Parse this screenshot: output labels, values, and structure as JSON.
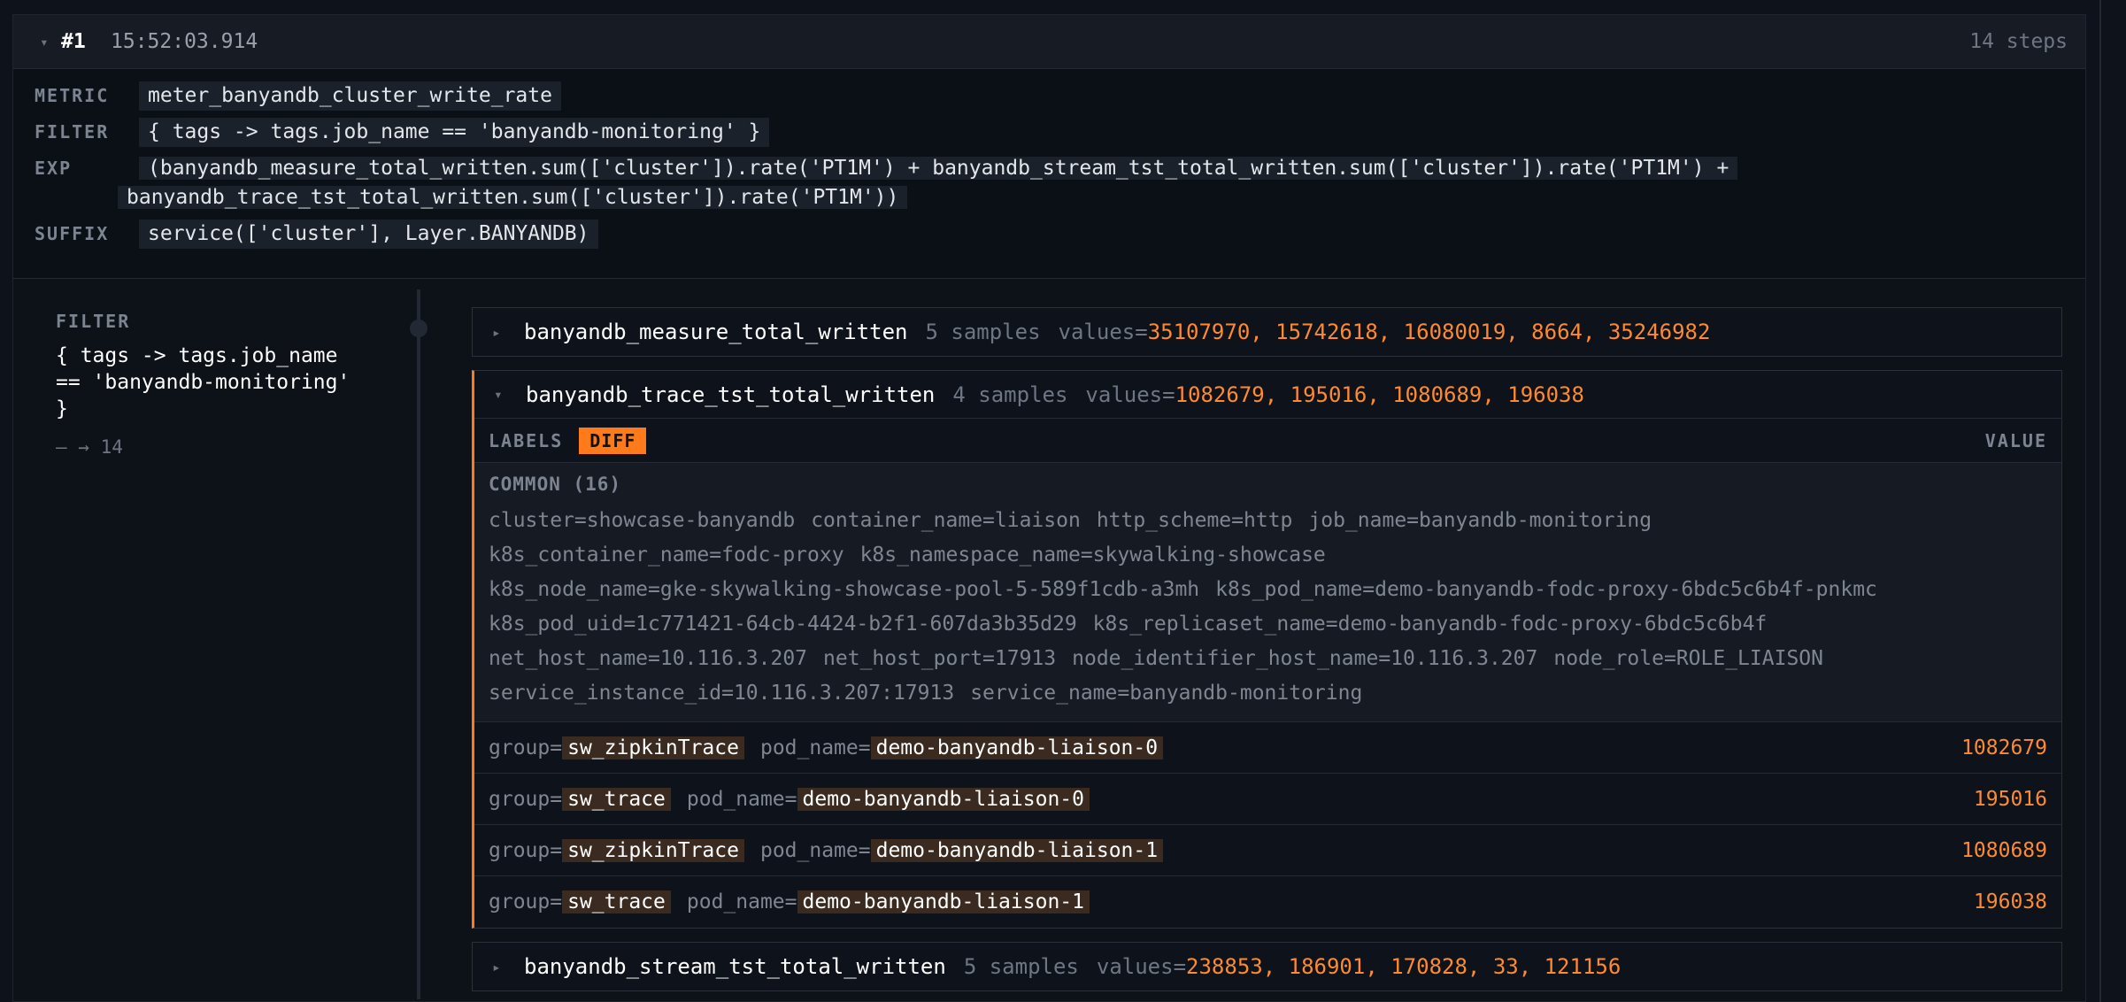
{
  "header": {
    "caret": "▾",
    "number": "#1",
    "time": "15:52:03.914",
    "steps": "14 steps"
  },
  "meta": {
    "metric_key": "METRIC",
    "metric_value": "meter_banyandb_cluster_write_rate",
    "filter_key": "FILTER",
    "filter_value": "{ tags -> tags.job_name == 'banyandb-monitoring' }",
    "exp_key": "EXP",
    "exp_line1": "(banyandb_measure_total_written.sum(['cluster']).rate('PT1M') + banyandb_stream_tst_total_written.sum(['cluster']).rate('PT1M') +",
    "exp_line2": "banyandb_trace_tst_total_written.sum(['cluster']).rate('PT1M'))",
    "suffix_key": "SUFFIX",
    "suffix_value": "service(['cluster'], Layer.BANYANDB)"
  },
  "step": {
    "label": "FILTER",
    "code": "{ tags -> tags.job_name\n== 'banyandb-monitoring'\n}",
    "count": "— → 14"
  },
  "items": [
    {
      "twisty": "▸",
      "name": "banyandb_measure_total_written",
      "samples": "5 samples",
      "values_key": "values=",
      "values": "35107970, 15742618, 16080019, 8664, 35246982"
    },
    {
      "twisty": "▾",
      "name": "banyandb_trace_tst_total_written",
      "samples": "4 samples",
      "values_key": "values=",
      "values": "1082679, 195016, 1080689, 196038"
    },
    {
      "twisty": "▸",
      "name": "banyandb_stream_tst_total_written",
      "samples": "5 samples",
      "values_key": "values=",
      "values": "238853, 186901, 170828, 33, 121156"
    }
  ],
  "expanded": {
    "labels_header": "LABELS",
    "diff_button": "DIFF",
    "value_header": "VALUE",
    "common_header": "COMMON (16)",
    "common_tags": [
      "cluster=showcase-banyandb",
      "container_name=liaison",
      "http_scheme=http",
      "job_name=banyandb-monitoring",
      "k8s_container_name=fodc-proxy",
      "k8s_namespace_name=skywalking-showcase",
      "k8s_node_name=gke-skywalking-showcase-pool-5-589f1cdb-a3mh",
      "k8s_pod_name=demo-banyandb-fodc-proxy-6bdc5c6b4f-pnkmc",
      "k8s_pod_uid=1c771421-64cb-4424-b2f1-607da3b35d29",
      "k8s_replicaset_name=demo-banyandb-fodc-proxy-6bdc5c6b4f",
      "net_host_name=10.116.3.207",
      "net_host_port=17913",
      "node_identifier_host_name=10.116.3.207",
      "node_role=ROLE_LIAISON",
      "service_instance_id=10.116.3.207:17913",
      "service_name=banyandb-monitoring"
    ],
    "rows": [
      {
        "k1": "group=",
        "v1": "sw_zipkinTrace",
        "k2": "pod_name=",
        "v2": "demo-banyandb-liaison-0",
        "value": "1082679"
      },
      {
        "k1": "group=",
        "v1": "sw_trace",
        "k2": "pod_name=",
        "v2": "demo-banyandb-liaison-0",
        "value": "195016"
      },
      {
        "k1": "group=",
        "v1": "sw_zipkinTrace",
        "k2": "pod_name=",
        "v2": "demo-banyandb-liaison-1",
        "value": "1080689"
      },
      {
        "k1": "group=",
        "v1": "sw_trace",
        "k2": "pod_name=",
        "v2": "demo-banyandb-liaison-1",
        "value": "196038"
      }
    ]
  },
  "colors": {
    "accent": "#ff7a1a",
    "value": "#ff8a2e",
    "background": "#0d1118"
  }
}
